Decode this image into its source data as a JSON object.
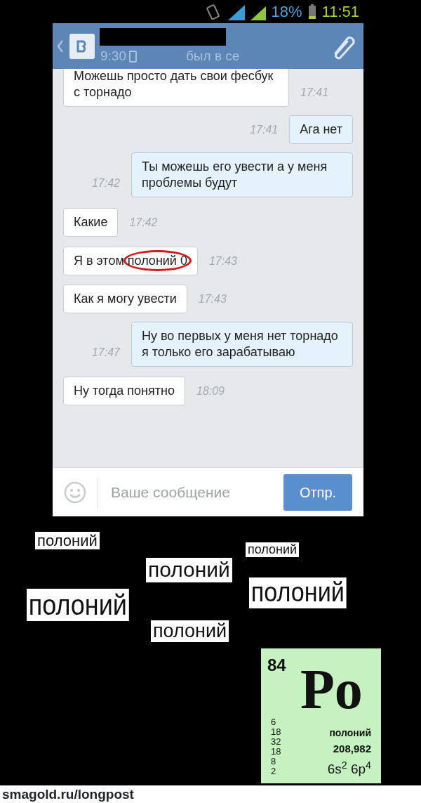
{
  "status_bar": {
    "battery": "18%",
    "time": "11:51"
  },
  "chat": {
    "header": {
      "last_seen_time": "9:30",
      "status": "был в се"
    },
    "messages": [
      {
        "kind": "in",
        "text": "Можешь просто дать свои фесбук с торнадо",
        "time": "17:41"
      },
      {
        "kind": "out",
        "text": "Ага нет",
        "time": "17:41"
      },
      {
        "kind": "out",
        "text": "Ты можешь его увести а у меня проблемы будут",
        "time": "17:42"
      },
      {
        "kind": "in",
        "text": "Какие",
        "time": "17:42"
      },
      {
        "kind": "in",
        "text": "Я в этом",
        "circled_text": "полоний 0",
        "time": "17:43"
      },
      {
        "kind": "in",
        "text": "Как я могу увести",
        "time": "17:43"
      },
      {
        "kind": "out",
        "text": "Ну во первых у меня нет торнадо я только его зарабатываю",
        "time": "17:47"
      },
      {
        "kind": "in",
        "text": "Ну тогда понятно",
        "time": "18:09"
      }
    ],
    "input": {
      "placeholder": "Ваше сообщение"
    },
    "send_button": "Отпр."
  },
  "collage_labels": [
    "полоний",
    "полоний",
    "полоний",
    "полоний",
    "полоний",
    "полоний"
  ],
  "element_card": {
    "number": "84",
    "symbol": "Po",
    "name": "полоний",
    "mass": "208,982",
    "shells": [
      "6",
      "18",
      "32",
      "18",
      "8",
      "2"
    ],
    "configuration": "6s$^{2}$ 6p$^{4}$"
  },
  "footer": "smagold.ru/longpost"
}
